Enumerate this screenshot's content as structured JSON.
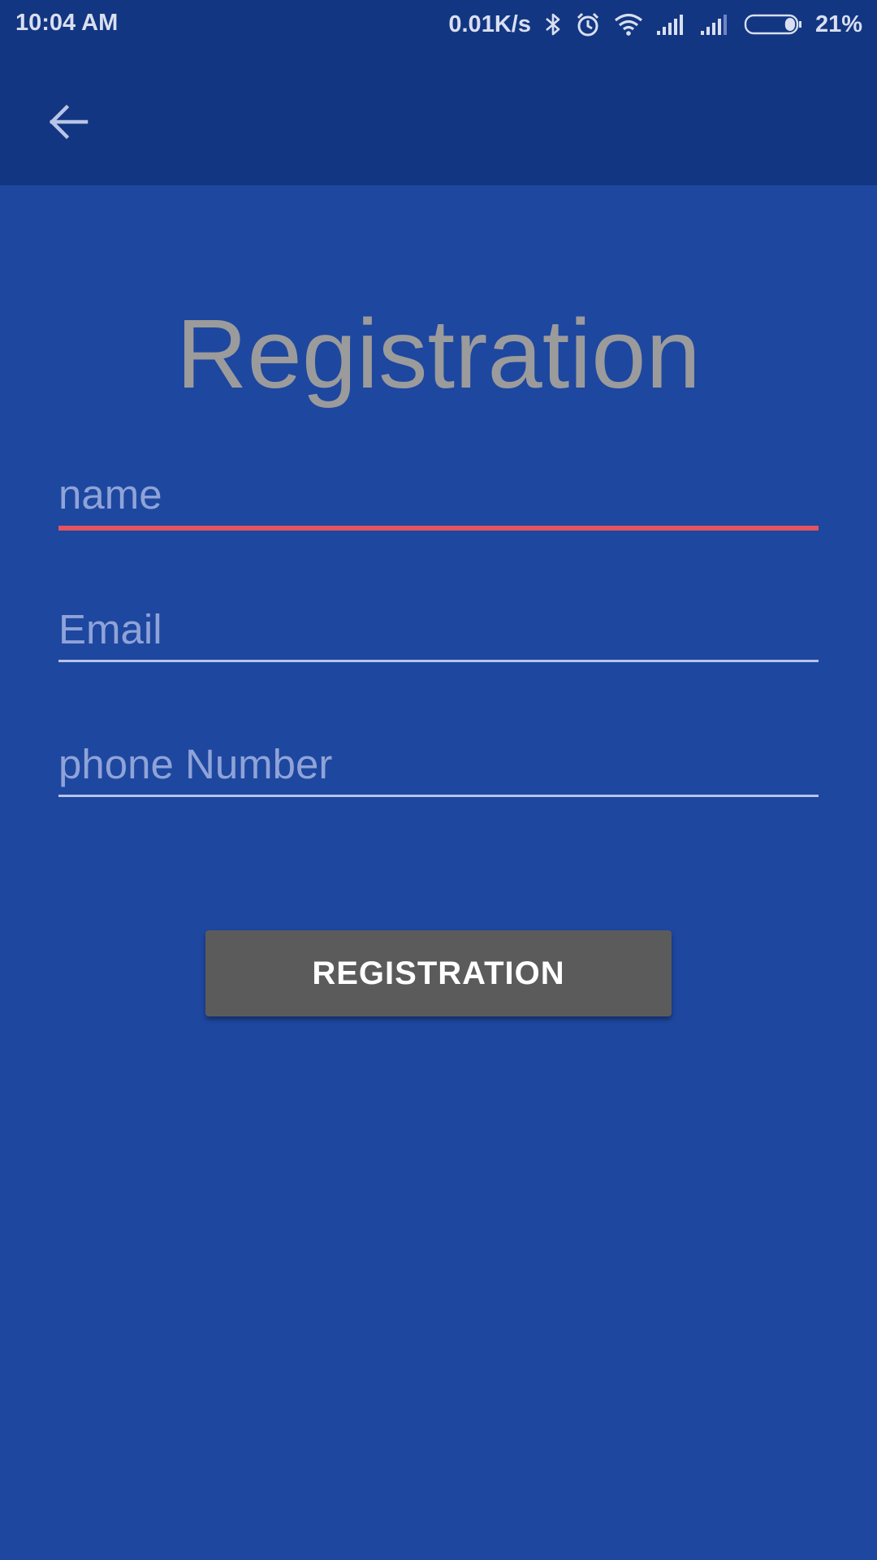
{
  "status_bar": {
    "time": "10:04 AM",
    "network_speed": "0.01K/s",
    "battery_percent": "21%",
    "battery_level": 0.21,
    "icons": [
      "bluetooth-icon",
      "alarm-icon",
      "wifi-icon",
      "signal-icon",
      "signal-icon",
      "battery-icon"
    ]
  },
  "app_bar": {
    "back_icon": "arrow-left-icon"
  },
  "form": {
    "title": "Registration",
    "name_placeholder": "name",
    "email_placeholder": "Email",
    "phone_placeholder": "phone Number",
    "submit_label": "REGISTRATION"
  },
  "colors": {
    "background": "#1e47a0",
    "app_bar": "#133682",
    "focused_underline": "#e25461",
    "underline": "#b7c4ea",
    "button": "#5b5b5b",
    "title_text": "#9b9b9b"
  }
}
